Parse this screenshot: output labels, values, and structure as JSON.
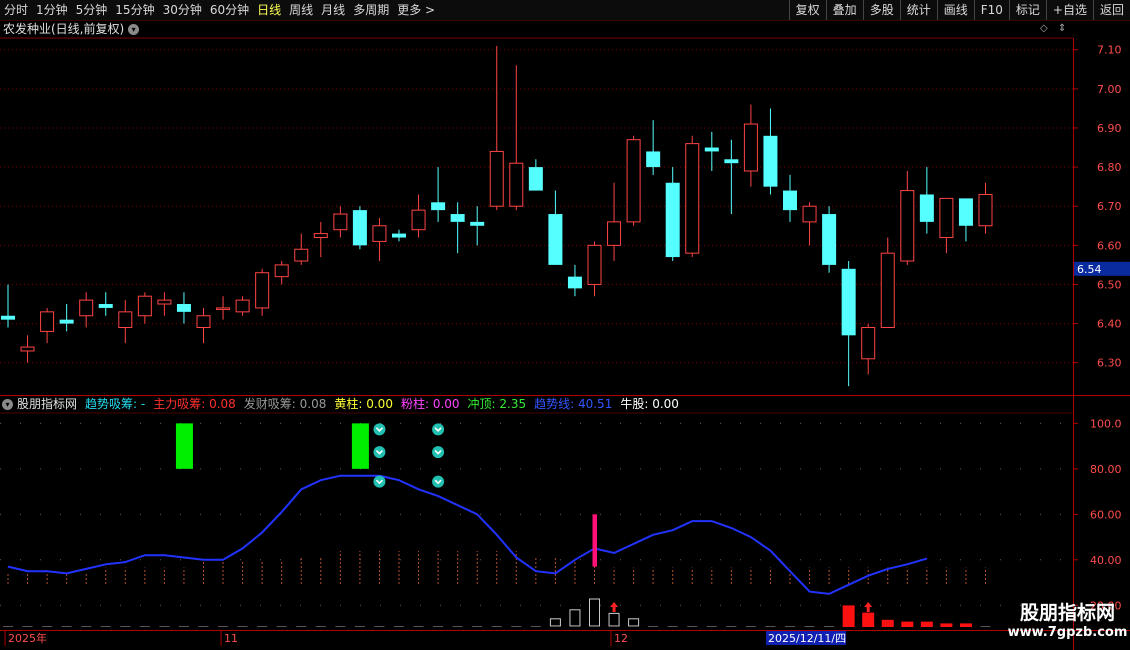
{
  "toolbar": {
    "periods": [
      {
        "label": "分时"
      },
      {
        "label": "1分钟"
      },
      {
        "label": "5分钟"
      },
      {
        "label": "15分钟"
      },
      {
        "label": "30分钟"
      },
      {
        "label": "60分钟"
      },
      {
        "label": "日线",
        "active": true
      },
      {
        "label": "周线"
      },
      {
        "label": "月线"
      },
      {
        "label": "多周期"
      },
      {
        "label": "更多 >"
      }
    ],
    "actions": [
      {
        "label": "复权"
      },
      {
        "label": "叠加"
      },
      {
        "label": "多股"
      },
      {
        "label": "统计"
      },
      {
        "label": "画线"
      },
      {
        "label": "F10"
      },
      {
        "label": "标记"
      },
      {
        "label": "+自选"
      },
      {
        "label": "返回"
      }
    ]
  },
  "stock": {
    "title": "农发种业(日线,前复权)"
  },
  "icons": {
    "title_menu": "chevron-down-icon",
    "indicator_menu": "chevron-down-icon",
    "diamond": "diamond-icon",
    "arrows": "up-down-arrows-icon"
  },
  "price_axis": {
    "labels": [
      "7.10",
      "7.00",
      "6.90",
      "6.80",
      "6.70",
      "6.60",
      "6.50",
      "6.40",
      "6.30"
    ],
    "current": "6.54"
  },
  "indicator": {
    "name": "股朋指标网",
    "items": [
      {
        "label": "趋势吸筹: ",
        "value": "-",
        "color": "#22ddee"
      },
      {
        "label": "主力吸筹: ",
        "value": "0.08",
        "color": "#ff3030"
      },
      {
        "label": "发财吸筹: ",
        "value": "0.08",
        "color": "#999999"
      },
      {
        "label": "黄柱: ",
        "value": "0.00",
        "color": "#ffff33"
      },
      {
        "label": "粉柱: ",
        "value": "0.00",
        "color": "#ff44ff"
      },
      {
        "label": "冲顶: ",
        "value": "2.35",
        "color": "#33ee33"
      },
      {
        "label": "趋势线: ",
        "value": "40.51",
        "color": "#3355ff"
      },
      {
        "label": "牛股: ",
        "value": "0.00",
        "color": "#ffffff"
      }
    ]
  },
  "indicator_axis": {
    "labels": [
      "100.0",
      "80.00",
      "60.00",
      "40.00",
      "20.00"
    ]
  },
  "date_axis": {
    "labels": [
      "2025年",
      "11",
      "12"
    ],
    "cursor": "2025/12/11/四"
  },
  "watermark": {
    "name": "股朋指标网",
    "url": "www.7gpzb.com"
  },
  "colors": {
    "up": "#ff4444",
    "down": "#55ffff",
    "grid": "#7a0000",
    "trend": "#2233ff",
    "accent_green": "#00ee00",
    "accent_pink": "#ff1177"
  },
  "chart_data": {
    "type": "candlestick",
    "ylim": [
      6.22,
      7.13
    ],
    "candles": [
      {
        "o": 6.42,
        "h": 6.5,
        "l": 6.39,
        "c": 6.41
      },
      {
        "o": 6.33,
        "h": 6.37,
        "l": 6.3,
        "c": 6.34
      },
      {
        "o": 6.38,
        "h": 6.44,
        "l": 6.35,
        "c": 6.43
      },
      {
        "o": 6.41,
        "h": 6.45,
        "l": 6.38,
        "c": 6.4
      },
      {
        "o": 6.42,
        "h": 6.48,
        "l": 6.39,
        "c": 6.46
      },
      {
        "o": 6.45,
        "h": 6.48,
        "l": 6.42,
        "c": 6.44
      },
      {
        "o": 6.39,
        "h": 6.46,
        "l": 6.35,
        "c": 6.43
      },
      {
        "o": 6.42,
        "h": 6.48,
        "l": 6.4,
        "c": 6.47
      },
      {
        "o": 6.45,
        "h": 6.48,
        "l": 6.42,
        "c": 6.46
      },
      {
        "o": 6.45,
        "h": 6.48,
        "l": 6.4,
        "c": 6.43
      },
      {
        "o": 6.39,
        "h": 6.44,
        "l": 6.35,
        "c": 6.42
      },
      {
        "o": 6.44,
        "h": 6.47,
        "l": 6.41,
        "c": 6.44
      },
      {
        "o": 6.43,
        "h": 6.47,
        "l": 6.42,
        "c": 6.46
      },
      {
        "o": 6.44,
        "h": 6.54,
        "l": 6.42,
        "c": 6.53
      },
      {
        "o": 6.52,
        "h": 6.56,
        "l": 6.5,
        "c": 6.55
      },
      {
        "o": 6.56,
        "h": 6.63,
        "l": 6.55,
        "c": 6.59
      },
      {
        "o": 6.62,
        "h": 6.66,
        "l": 6.57,
        "c": 6.63
      },
      {
        "o": 6.64,
        "h": 6.7,
        "l": 6.62,
        "c": 6.68
      },
      {
        "o": 6.69,
        "h": 6.7,
        "l": 6.59,
        "c": 6.6
      },
      {
        "o": 6.61,
        "h": 6.67,
        "l": 6.56,
        "c": 6.65
      },
      {
        "o": 6.63,
        "h": 6.64,
        "l": 6.61,
        "c": 6.62
      },
      {
        "o": 6.64,
        "h": 6.73,
        "l": 6.62,
        "c": 6.69
      },
      {
        "o": 6.71,
        "h": 6.8,
        "l": 6.66,
        "c": 6.69
      },
      {
        "o": 6.68,
        "h": 6.71,
        "l": 6.58,
        "c": 6.66
      },
      {
        "o": 6.66,
        "h": 6.7,
        "l": 6.6,
        "c": 6.65
      },
      {
        "o": 6.7,
        "h": 7.11,
        "l": 6.69,
        "c": 6.84
      },
      {
        "o": 6.7,
        "h": 7.06,
        "l": 6.69,
        "c": 6.81
      },
      {
        "o": 6.8,
        "h": 6.82,
        "l": 6.75,
        "c": 6.74
      },
      {
        "o": 6.68,
        "h": 6.74,
        "l": 6.56,
        "c": 6.55
      },
      {
        "o": 6.52,
        "h": 6.55,
        "l": 6.47,
        "c": 6.49
      },
      {
        "o": 6.5,
        "h": 6.61,
        "l": 6.47,
        "c": 6.6
      },
      {
        "o": 6.6,
        "h": 6.76,
        "l": 6.56,
        "c": 6.66
      },
      {
        "o": 6.66,
        "h": 6.88,
        "l": 6.65,
        "c": 6.87
      },
      {
        "o": 6.84,
        "h": 6.92,
        "l": 6.78,
        "c": 6.8
      },
      {
        "o": 6.76,
        "h": 6.8,
        "l": 6.56,
        "c": 6.57
      },
      {
        "o": 6.58,
        "h": 6.88,
        "l": 6.57,
        "c": 6.86
      },
      {
        "o": 6.85,
        "h": 6.89,
        "l": 6.79,
        "c": 6.84
      },
      {
        "o": 6.82,
        "h": 6.87,
        "l": 6.68,
        "c": 6.81
      },
      {
        "o": 6.79,
        "h": 6.96,
        "l": 6.75,
        "c": 6.91
      },
      {
        "o": 6.88,
        "h": 6.95,
        "l": 6.73,
        "c": 6.75
      },
      {
        "o": 6.74,
        "h": 6.78,
        "l": 6.66,
        "c": 6.69
      },
      {
        "o": 6.66,
        "h": 6.71,
        "l": 6.6,
        "c": 6.7
      },
      {
        "o": 6.68,
        "h": 6.7,
        "l": 6.53,
        "c": 6.55
      },
      {
        "o": 6.54,
        "h": 6.56,
        "l": 6.24,
        "c": 6.37
      },
      {
        "o": 6.31,
        "h": 6.4,
        "l": 6.27,
        "c": 6.39
      },
      {
        "o": 6.39,
        "h": 6.62,
        "l": 6.39,
        "c": 6.58
      },
      {
        "o": 6.56,
        "h": 6.79,
        "l": 6.55,
        "c": 6.74
      },
      {
        "o": 6.73,
        "h": 6.8,
        "l": 6.63,
        "c": 6.66
      },
      {
        "o": 6.62,
        "h": 6.72,
        "l": 6.58,
        "c": 6.72
      },
      {
        "o": 6.72,
        "h": 6.72,
        "l": 6.61,
        "c": 6.65
      },
      {
        "o": 6.65,
        "h": 6.76,
        "l": 6.63,
        "c": 6.73
      }
    ],
    "indicator": {
      "ylim": [
        10,
        105
      ],
      "trend_line": [
        37,
        35,
        35,
        34,
        36,
        38,
        39,
        42,
        42,
        41,
        40,
        40,
        45,
        52,
        61,
        71,
        75,
        77,
        77,
        77,
        75,
        71,
        68,
        64,
        60,
        51,
        41,
        35,
        34,
        40,
        45,
        43,
        47,
        51,
        53,
        57,
        57,
        54,
        50,
        44,
        35,
        26,
        25,
        29,
        33,
        36,
        38,
        40.51
      ],
      "green_bars": [
        9,
        18
      ],
      "down_markers": [
        [
          19,
          100
        ],
        [
          19,
          90
        ],
        [
          19,
          77
        ],
        [
          22,
          100
        ],
        [
          22,
          90
        ],
        [
          22,
          77
        ]
      ],
      "pink_bar": {
        "i": 30,
        "top": 60,
        "bottom": 37
      },
      "volume_ticks": [
        2,
        2,
        2,
        2,
        2,
        3,
        3,
        3,
        3,
        3,
        4,
        4,
        4,
        4,
        4,
        5,
        5,
        6,
        6,
        6,
        6,
        6,
        6,
        6,
        6,
        6,
        6,
        5,
        5,
        4,
        4,
        3,
        3,
        3,
        3,
        3,
        3,
        3,
        3,
        3,
        3,
        3,
        3,
        3,
        3,
        3,
        3,
        3,
        3,
        3,
        3
      ],
      "bottom_hollow": [
        [
          28,
          4
        ],
        [
          29,
          9
        ],
        [
          30,
          15
        ],
        [
          31,
          7
        ],
        [
          32,
          4
        ]
      ],
      "bottom_red": [
        [
          43,
          12
        ],
        [
          44,
          8
        ],
        [
          45,
          4
        ],
        [
          46,
          3
        ],
        [
          47,
          3
        ],
        [
          48,
          2
        ],
        [
          49,
          2
        ]
      ],
      "up_markers": [
        31,
        44
      ]
    }
  }
}
